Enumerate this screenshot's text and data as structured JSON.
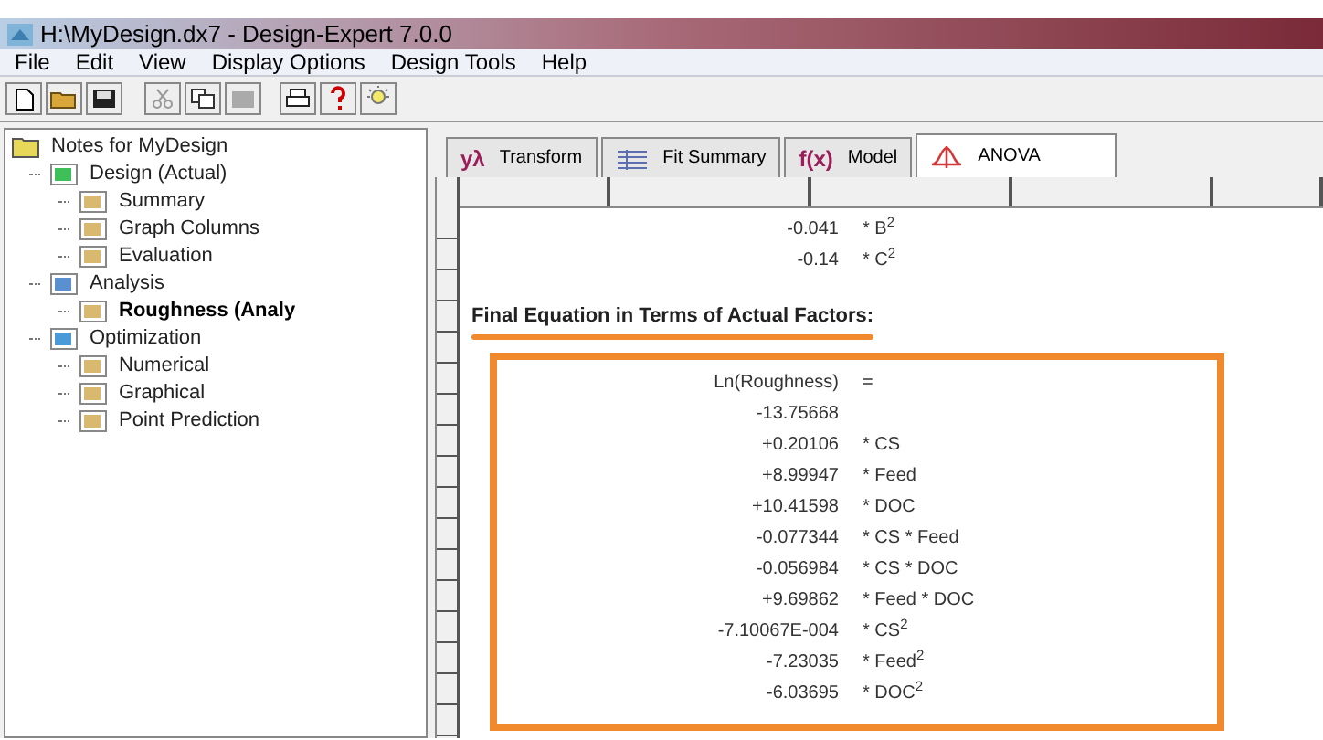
{
  "window": {
    "title": "H:\\MyDesign.dx7 - Design-Expert 7.0.0"
  },
  "menu": [
    "File",
    "Edit",
    "View",
    "Display Options",
    "Design Tools",
    "Help"
  ],
  "tree": {
    "label": "Notes for MyDesign",
    "children": [
      {
        "label": "Design (Actual)",
        "selected": false,
        "children": [
          {
            "label": "Summary",
            "selected": false
          },
          {
            "label": "Graph Columns",
            "selected": false
          },
          {
            "label": "Evaluation",
            "selected": false
          }
        ]
      },
      {
        "label": "Analysis",
        "selected": false,
        "children": [
          {
            "label": "Roughness (Analy",
            "selected": true
          }
        ]
      },
      {
        "label": "Optimization",
        "selected": false,
        "children": [
          {
            "label": "Numerical",
            "selected": false
          },
          {
            "label": "Graphical",
            "selected": false
          },
          {
            "label": "Point Prediction",
            "selected": false
          }
        ]
      }
    ]
  },
  "tabs": [
    {
      "icon": "yλ",
      "label": "Transform",
      "selected": false
    },
    {
      "label": "Fit Summary",
      "selected": false
    },
    {
      "icon": "f(x)",
      "label": "Model",
      "selected": false
    },
    {
      "label": "ANOVA",
      "selected": true
    }
  ],
  "coded_terms": [
    {
      "value": "-0.041",
      "term": "* B$^{2}$"
    },
    {
      "value": "-0.14",
      "term": "* C$^{2}$"
    }
  ],
  "heading": "Final Equation in Terms of Actual Factors:",
  "equation": [
    {
      "value": "Ln(Roughness)",
      "term": "="
    },
    {
      "value": "-13.75668"
    },
    {
      "value": "+0.20106",
      "term": "* CS"
    },
    {
      "value": "+8.99947",
      "term": "* Feed"
    },
    {
      "value": "+10.41598",
      "term": "* DOC"
    },
    {
      "value": "-0.077344",
      "term": "* CS * Feed"
    },
    {
      "value": "-0.056984",
      "term": "* CS * DOC"
    },
    {
      "value": "+9.69862",
      "term": "* Feed * DOC"
    },
    {
      "value": "-7.10067E-004",
      "term": "* CS$^{2}$"
    },
    {
      "value": "-7.23035",
      "term": "* Feed$^{2}$"
    },
    {
      "value": "-6.03695",
      "term": "* DOC$^{2}$"
    }
  ]
}
